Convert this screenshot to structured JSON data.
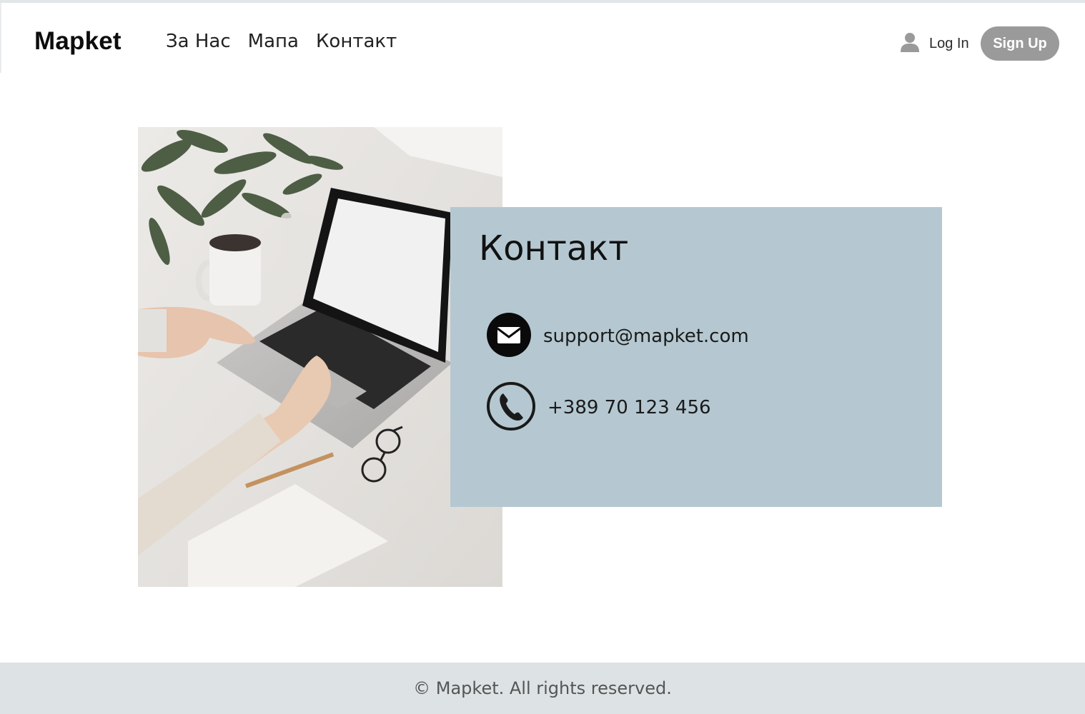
{
  "header": {
    "brand": "Mapket",
    "nav": [
      {
        "label": "За Нас"
      },
      {
        "label": "Мапа"
      },
      {
        "label": "Контакт"
      }
    ],
    "login_label": "Log In",
    "signup_label": "Sign Up",
    "login_icon": "user-icon"
  },
  "contact": {
    "title": "Контакт",
    "email": "support@mapket.com",
    "email_icon": "envelope-icon",
    "phone": "+389 70 123 456",
    "phone_icon": "phone-icon",
    "card_color": "#b5c8d1"
  },
  "footer": {
    "text": "© Mapket. All rights reserved."
  },
  "colors": {
    "signup_bg": "#9a9a9a",
    "footer_bg": "#dde2e4"
  }
}
